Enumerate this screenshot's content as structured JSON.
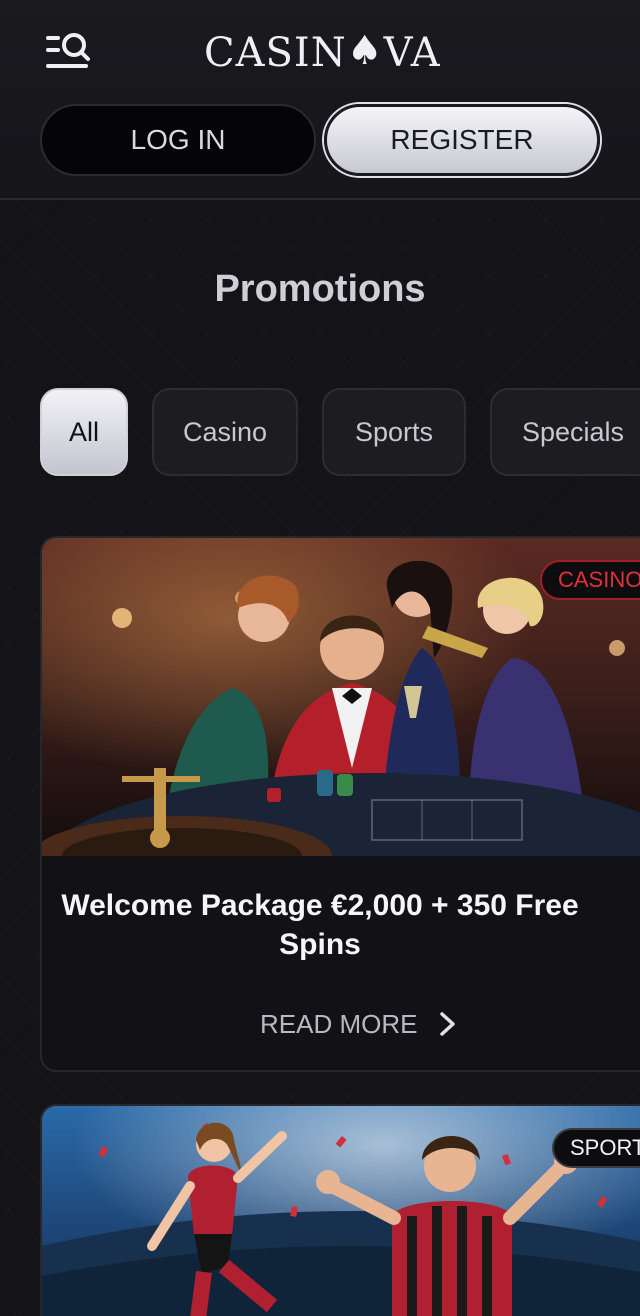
{
  "header": {
    "logo_text_a": "CASIN",
    "logo_text_b": "VA",
    "login_label": "LOG IN",
    "register_label": "REGISTER"
  },
  "page_title": "Promotions",
  "filters": [
    {
      "label": "All",
      "active": true
    },
    {
      "label": "Casino",
      "active": false
    },
    {
      "label": "Sports",
      "active": false
    },
    {
      "label": "Specials",
      "active": false
    }
  ],
  "promos": [
    {
      "badge": "CASINO",
      "title": "Welcome Package €2,000 + 350 Free Spins",
      "cta": "READ MORE"
    },
    {
      "badge": "SPORT"
    }
  ],
  "colors": {
    "background": "#141418",
    "accent_red": "#e0303a",
    "light_button": "#e8e8ee"
  },
  "icons": {
    "menu": "menu-search-icon",
    "logo_symbol": "spade-icon",
    "cta_arrow": "chevron-right-icon"
  }
}
